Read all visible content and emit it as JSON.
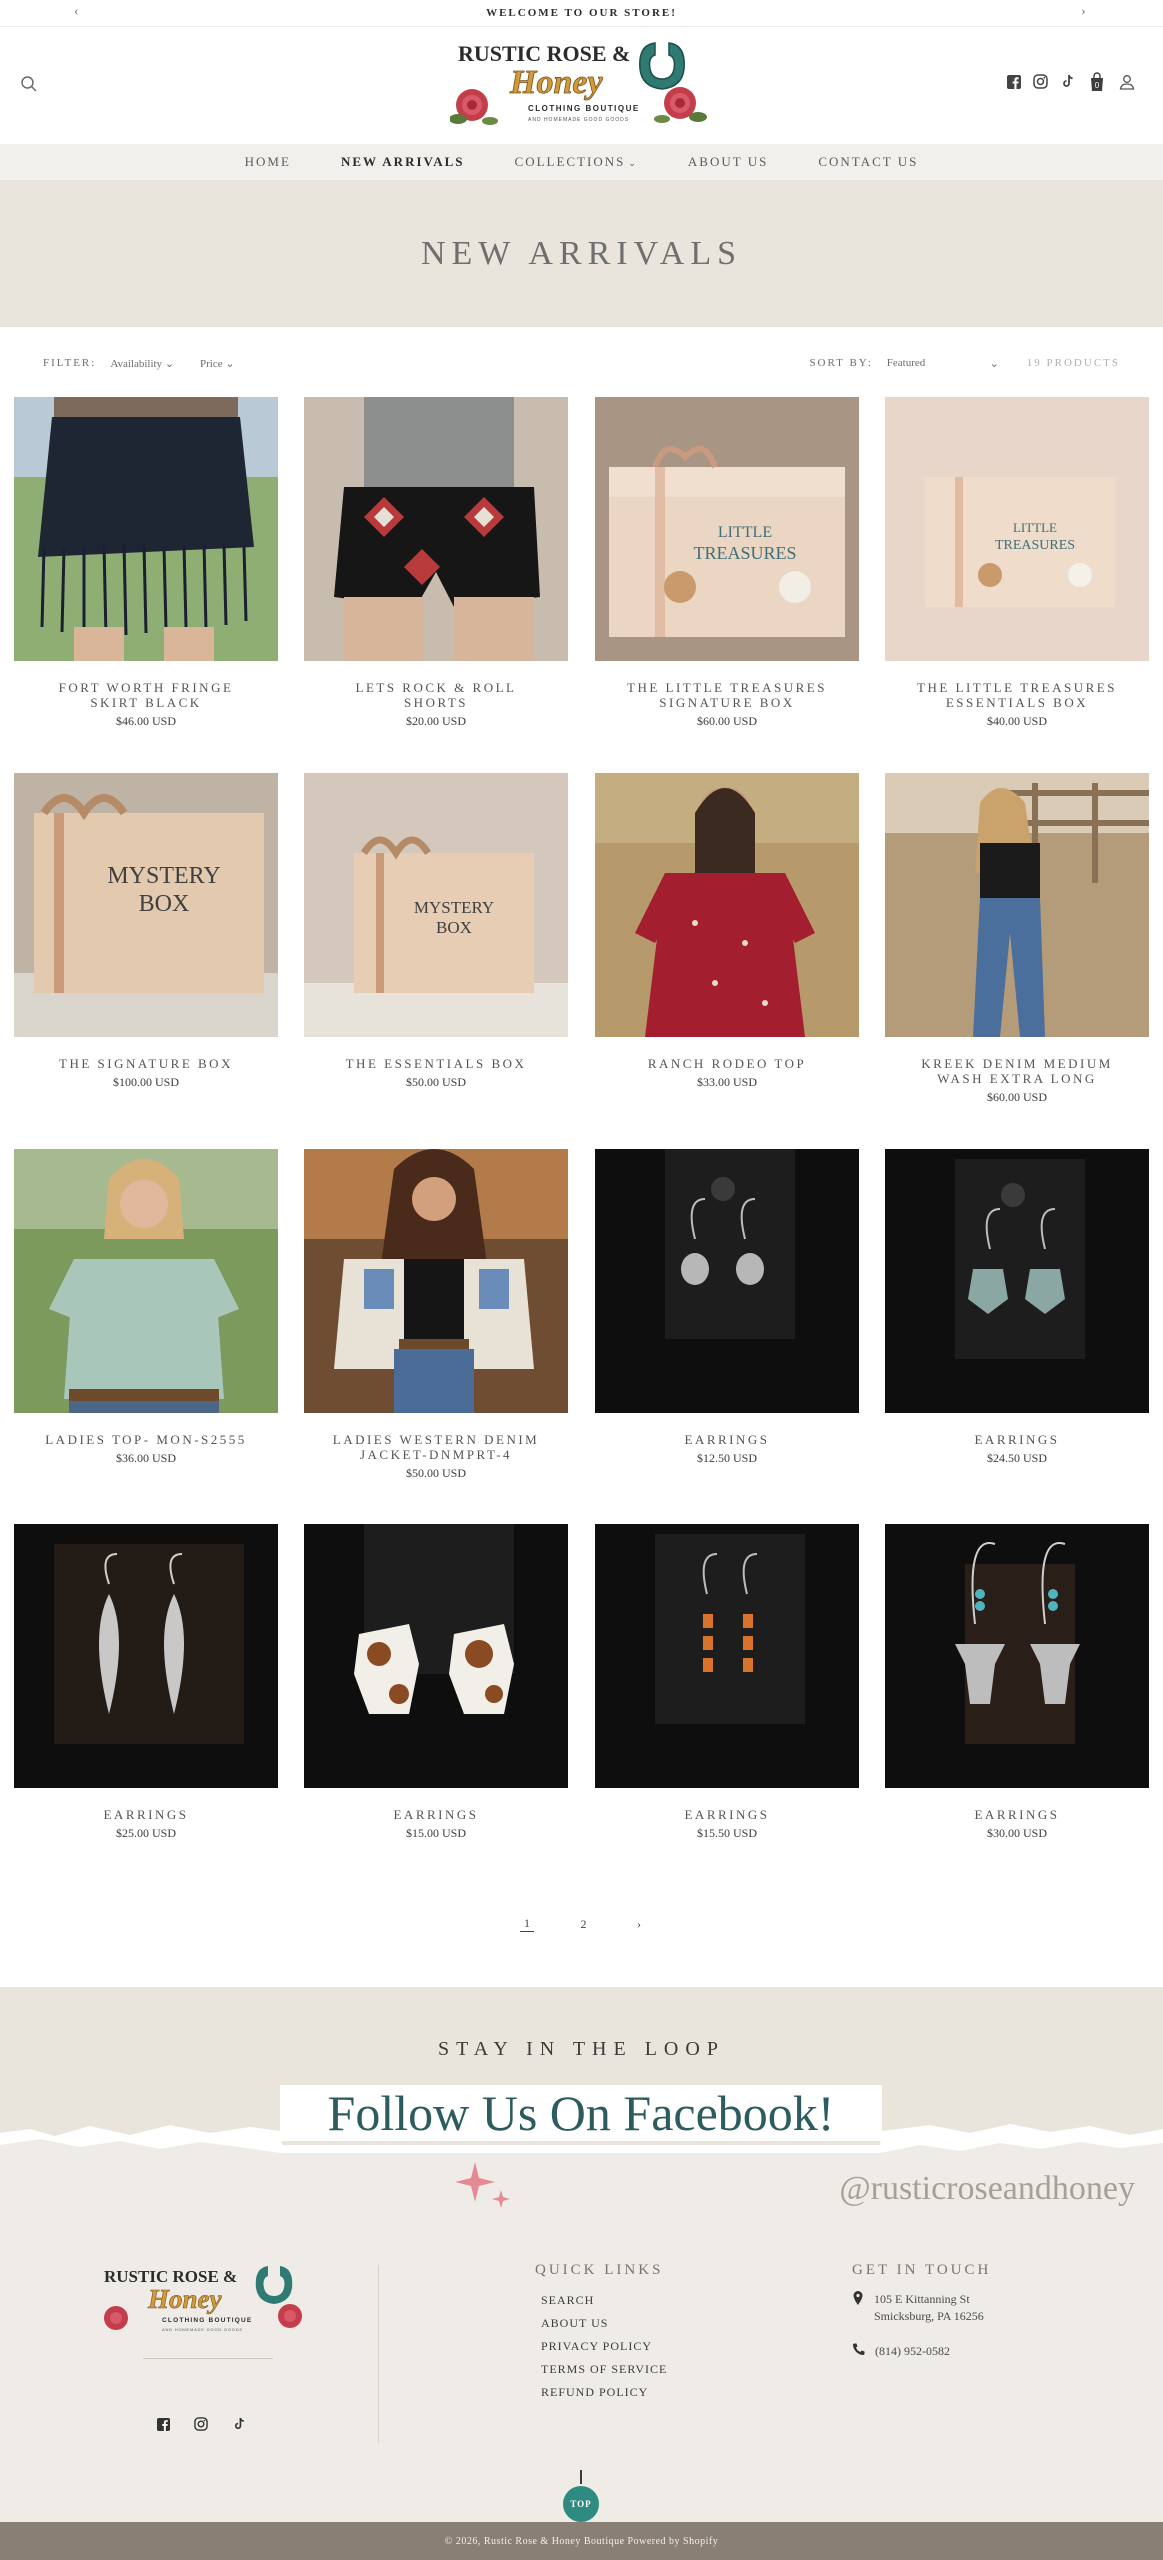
{
  "announcement": {
    "message": "WELCOME TO OUR STORE!",
    "prev": "‹",
    "next": "›"
  },
  "brand": {
    "name_line1": "RUSTIC ROSE &",
    "name_line2": "Honey",
    "tagline": "CLOTHING BOUTIQUE",
    "subtag": "AND HOMEMADE GOOD GOODS"
  },
  "nav": [
    {
      "label": "HOME"
    },
    {
      "label": "NEW ARRIVALS",
      "active": true
    },
    {
      "label": "COLLECTIONS",
      "has_dropdown": true
    },
    {
      "label": "ABOUT US"
    },
    {
      "label": "CONTACT US"
    }
  ],
  "cart": {
    "count": "0"
  },
  "page": {
    "title": "NEW ARRIVALS"
  },
  "filters": {
    "label": "FILTER:",
    "availability": "Availability",
    "price": "Price",
    "sort_label": "SORT BY:",
    "sort_value": "Featured",
    "product_count": "19 PRODUCTS"
  },
  "products": [
    {
      "title": "FORT WORTH FRINGE SKIRT BLACK",
      "price": "$46.00 USD",
      "image": "fringe-skirt"
    },
    {
      "title": "LETS ROCK & ROLL SHORTS",
      "price": "$20.00 USD",
      "image": "aztec-shorts"
    },
    {
      "title": "THE LITTLE TREASURES SIGNATURE BOX",
      "price": "$60.00 USD",
      "image": "treasure-box"
    },
    {
      "title": "THE LITTLE TREASURES ESSENTIALS BOX",
      "price": "$40.00 USD",
      "image": "treasure-box-small"
    },
    {
      "title": "THE SIGNATURE BOX",
      "price": "$100.00 USD",
      "image": "mystery-box"
    },
    {
      "title": "THE ESSENTIALS BOX",
      "price": "$50.00 USD",
      "image": "mystery-box-small"
    },
    {
      "title": "RANCH RODEO TOP",
      "price": "$33.00 USD",
      "image": "red-top"
    },
    {
      "title": "KREEK DENIM MEDIUM WASH EXTRA LONG",
      "price": "$60.00 USD",
      "image": "denim-jeans"
    },
    {
      "title": "LADIES TOP- MON-S2555",
      "price": "$36.00 USD",
      "image": "sage-top"
    },
    {
      "title": "LADIES WESTERN DENIM JACKET-DNMPRT-4",
      "price": "$50.00 USD",
      "image": "denim-jacket"
    },
    {
      "title": "EARRINGS",
      "price": "$12.50 USD",
      "image": "earrings-turtle"
    },
    {
      "title": "EARRINGS",
      "price": "$24.50 USD",
      "image": "earrings-cow"
    },
    {
      "title": "EARRINGS",
      "price": "$25.00 USD",
      "image": "earrings-feather"
    },
    {
      "title": "EARRINGS",
      "price": "$15.00 USD",
      "image": "earrings-cowhide"
    },
    {
      "title": "EARRINGS",
      "price": "$15.50 USD",
      "image": "earrings-orange"
    },
    {
      "title": "EARRINGS",
      "price": "$30.00 USD",
      "image": "earrings-skull"
    }
  ],
  "pagination": {
    "current": "1",
    "next_page": "2",
    "next": "›"
  },
  "newsletter": {
    "eyebrow": "STAY IN THE LOOP",
    "headline": "Follow Us On Facebook!",
    "handle": "@rusticroseandhoney"
  },
  "footer": {
    "quick_links_title": "QUICK LINKS",
    "links": [
      "SEARCH",
      "ABOUT US",
      "PRIVACY POLICY",
      "TERMS OF SERVICE",
      "REFUND POLICY"
    ],
    "contact_title": "GET IN TOUCH",
    "address_line1": "105 E Kittanning St",
    "address_line2": "Smicksburg, PA 16256",
    "phone": "(814) 952-0582",
    "top_label": "TOP",
    "copyright": "© 2026, Rustic Rose & Honey Boutique Powered by Shopify"
  },
  "colors": {
    "accent": "#2f8a82",
    "banner_bg": "#e9e5dc",
    "nav_bg": "#f2f0ec",
    "footer_bg": "#efece7",
    "copyright_bg": "#8a7f75",
    "headline": "#2c5c5f"
  }
}
